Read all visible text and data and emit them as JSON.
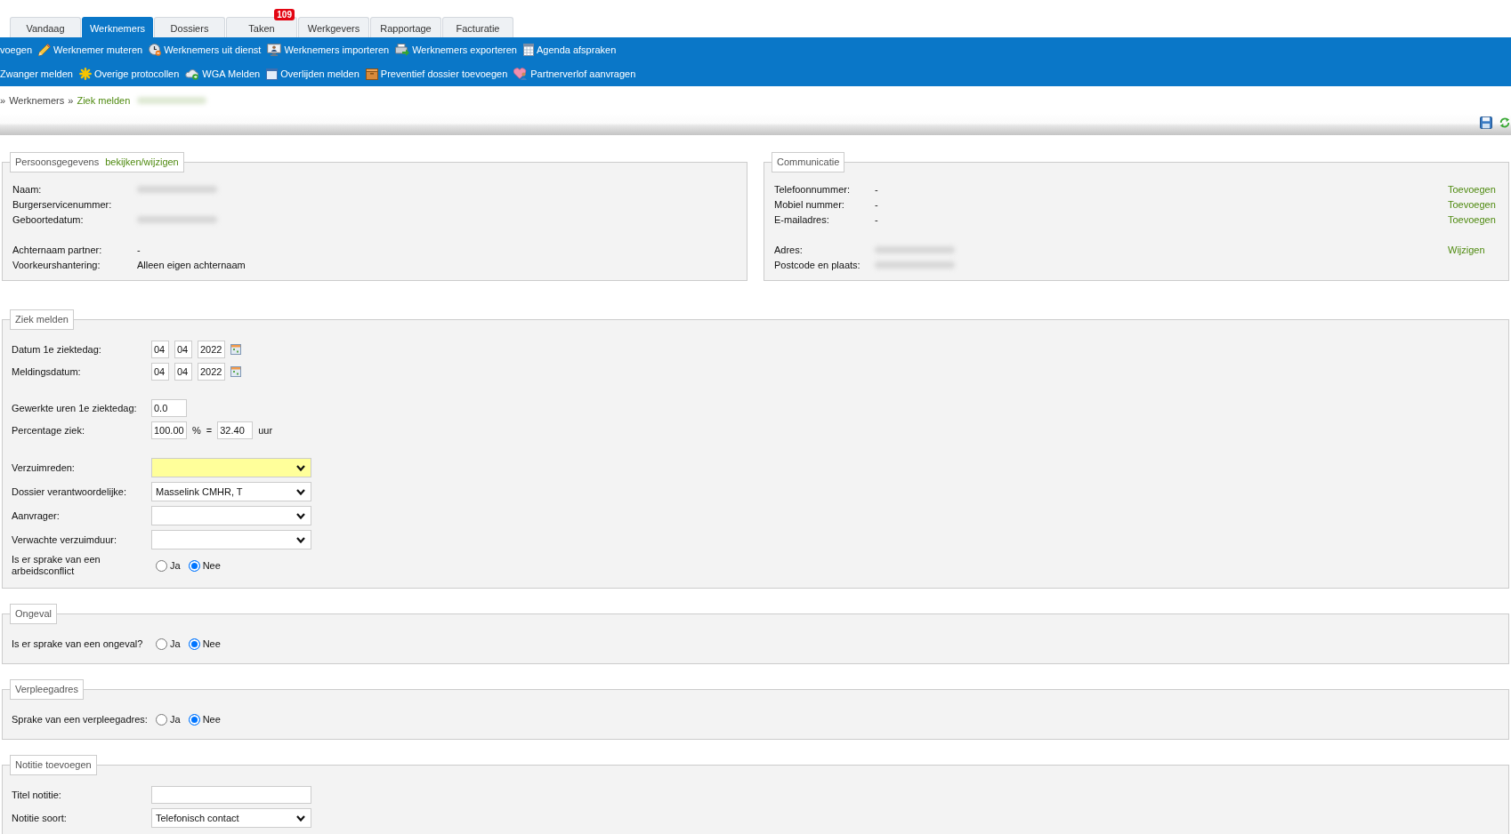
{
  "tabs": [
    {
      "label": "Vandaag",
      "selected": false
    },
    {
      "label": "Werknemers",
      "selected": true
    },
    {
      "label": "Dossiers",
      "selected": false
    },
    {
      "label": "Taken",
      "selected": false,
      "badge": "109"
    },
    {
      "label": "Werkgevers",
      "selected": false
    },
    {
      "label": "Rapportage",
      "selected": false
    },
    {
      "label": "Facturatie",
      "selected": false
    }
  ],
  "toolbar": {
    "rows": [
      [
        {
          "label": "voegen"
        },
        {
          "label": "Werknemer muteren"
        },
        {
          "label": "Werknemers uit dienst"
        },
        {
          "label": "Werknemers importeren"
        },
        {
          "label": "Werknemers exporteren"
        },
        {
          "label": "Agenda afspraken"
        }
      ],
      [
        {
          "label": "Zwanger melden"
        },
        {
          "label": "Overige protocollen"
        },
        {
          "label": "WGA Melden"
        },
        {
          "label": "Overlijden melden"
        },
        {
          "label": "Preventief dossier toevoegen"
        },
        {
          "label": "Partnerverlof aanvragen"
        }
      ]
    ]
  },
  "breadcrumb": {
    "separator": "»",
    "items": [
      {
        "label": "Werknemers",
        "kind": "text"
      },
      {
        "label": "Ziek melden",
        "kind": "link"
      },
      {
        "kind": "redacted"
      }
    ]
  },
  "personal_panel": {
    "title": "Persoonsgegevens",
    "link": "bekijken/wijzigen",
    "groups": [
      [
        {
          "label": "Naam:",
          "redacted": true
        },
        {
          "label": "Burgerservicenummer:"
        },
        {
          "label": "Geboortedatum:",
          "redacted": true
        }
      ],
      [
        {
          "label": "Achternaam partner:",
          "value": "-"
        },
        {
          "label": "Voorkeurshantering:",
          "value": "Alleen eigen achternaam"
        }
      ]
    ]
  },
  "communication_panel": {
    "title": "Communicatie",
    "groups": [
      [
        {
          "label": "Telefoonnummer:",
          "value": "-",
          "action": "Toevoegen"
        },
        {
          "label": "Mobiel nummer:",
          "value": "-",
          "action": "Toevoegen"
        },
        {
          "label": "E-mailadres:",
          "value": "-",
          "action": "Toevoegen"
        }
      ],
      [
        {
          "label": "Adres:",
          "redacted": true,
          "action": "Wijzigen"
        },
        {
          "label": "Postcode en plaats:",
          "redacted": true
        }
      ]
    ]
  },
  "sections": [
    {
      "title": "Ziek melden",
      "groups": [
        [
          {
            "kind": "date",
            "label": "Datum 1e ziektedag:",
            "day": "04",
            "month": "04",
            "year": "2022"
          },
          {
            "kind": "date",
            "label": "Meldingsdatum:",
            "day": "04",
            "month": "04",
            "year": "2022"
          }
        ],
        [
          {
            "kind": "number",
            "label": "Gewerkte uren 1e ziektedag:",
            "value": "0.0"
          },
          {
            "kind": "percentage",
            "label": "Percentage ziek:",
            "value": "100.00",
            "unit": "%",
            "equals": "=",
            "hours": "32.40",
            "hours_unit": "uur"
          }
        ],
        [
          {
            "kind": "select",
            "label": "Verzuimreden:",
            "highlighted": true
          },
          {
            "kind": "select",
            "label": "Dossier verantwoordelijke:",
            "value": "Masselink CMHR, T",
            "highlighted": false
          },
          {
            "kind": "select",
            "label": "Aanvrager:",
            "highlighted": false
          },
          {
            "kind": "select",
            "label": "Verwachte verzuimduur:",
            "highlighted": false
          },
          {
            "kind": "radio",
            "label": "Is er sprake van een arbeidsconflict",
            "options": [
              {
                "label": "Ja",
                "selected": false
              },
              {
                "label": "Nee",
                "selected": true
              }
            ]
          }
        ]
      ]
    },
    {
      "title": "Ongeval",
      "groups": [
        [
          {
            "kind": "radio",
            "label": "Is er sprake van een ongeval?",
            "options": [
              {
                "label": "Ja",
                "selected": false
              },
              {
                "label": "Nee",
                "selected": true
              }
            ]
          }
        ]
      ]
    },
    {
      "title": "Verpleegadres",
      "groups": [
        [
          {
            "kind": "radio",
            "label": "Sprake van een verpleegadres:",
            "options": [
              {
                "label": "Ja",
                "selected": false
              },
              {
                "label": "Nee",
                "selected": true
              }
            ]
          }
        ]
      ]
    },
    {
      "title": "Notitie toevoegen",
      "groups": [
        [
          {
            "kind": "text",
            "label": "Titel notitie:"
          },
          {
            "kind": "select",
            "label": "Notitie soort:",
            "value": "Telefonisch contact",
            "highlighted": false
          }
        ]
      ]
    }
  ]
}
